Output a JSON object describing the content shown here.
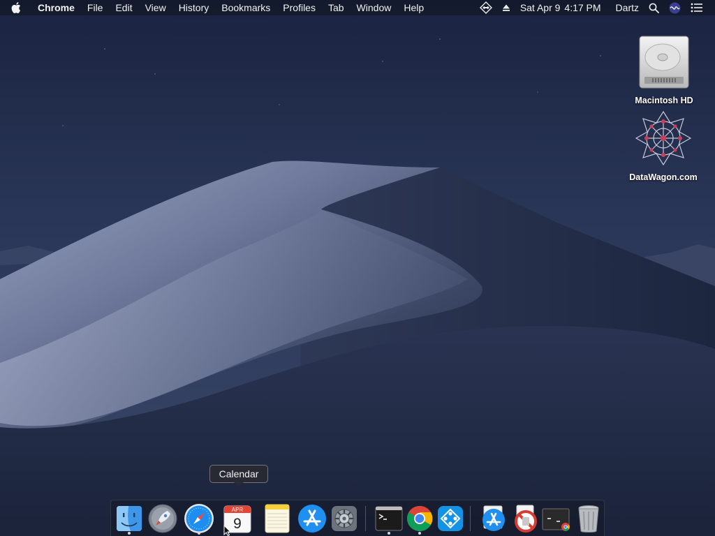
{
  "menubar": {
    "app_name": "Chrome",
    "menus": [
      "File",
      "Edit",
      "View",
      "History",
      "Bookmarks",
      "Profiles",
      "Tab",
      "Window",
      "Help"
    ],
    "status": {
      "date": "Sat Apr 9",
      "time": "4:17 PM",
      "user": "Dartz"
    },
    "icons": [
      "apple-icon",
      "teamviewer-icon",
      "eject-icon",
      "spotlight-icon",
      "siri-icon",
      "notification-center-icon"
    ]
  },
  "desktop": {
    "items": [
      {
        "label": "Macintosh HD",
        "icon": "hard-drive-icon"
      },
      {
        "label": "DataWagon.com",
        "icon": "datawagon-logo-icon"
      }
    ]
  },
  "dock": {
    "tooltip": "Calendar",
    "calendar": {
      "month": "APR",
      "day": "9"
    },
    "apps": [
      {
        "name": "Finder",
        "icon": "finder-icon",
        "running": true
      },
      {
        "name": "Launchpad",
        "icon": "launchpad-icon",
        "running": false
      },
      {
        "name": "Safari",
        "icon": "safari-icon",
        "running": true
      },
      {
        "name": "Calendar",
        "icon": "calendar-icon",
        "running": false
      },
      {
        "name": "Notes",
        "icon": "notes-icon",
        "running": false
      },
      {
        "name": "App Store",
        "icon": "app-store-icon",
        "running": false
      },
      {
        "name": "System Preferences",
        "icon": "system-preferences-icon",
        "running": false
      },
      {
        "name": "Terminal",
        "icon": "terminal-icon",
        "running": true
      },
      {
        "name": "Chrome",
        "icon": "chrome-icon",
        "running": true
      },
      {
        "name": "TeamViewer",
        "icon": "teamviewer-icon",
        "running": false
      },
      {
        "name": "App Store Downloads",
        "icon": "app-store-folder-icon",
        "running": false
      },
      {
        "name": "Blocked App",
        "icon": "blocked-app-icon",
        "running": false
      },
      {
        "name": "Chrome Apps",
        "icon": "chrome-apps-terminal-icon",
        "running": false
      },
      {
        "name": "Trash",
        "icon": "trash-icon",
        "running": false
      }
    ]
  },
  "colors": {
    "sky_top": "#1c2540",
    "dune_light": "#8d97b5",
    "dune_dark": "#26304c",
    "menubar": "#121828"
  }
}
